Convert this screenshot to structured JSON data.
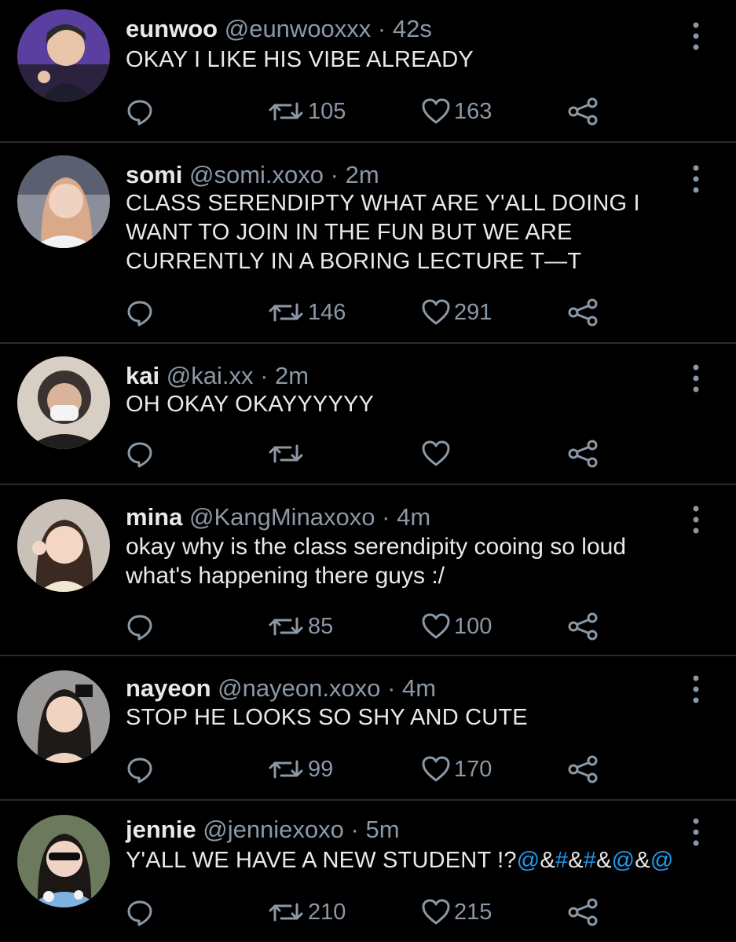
{
  "tweets": [
    {
      "name": "eunwoo",
      "handle": "@eunwooxxx",
      "time": "42s",
      "text": "OKAY I LIKE HIS VIBE ALREADY",
      "retweets": "105",
      "likes": "163"
    },
    {
      "name": "somi",
      "handle": "@somi.xoxo",
      "time": "2m",
      "text": "CLASS SERENDIPTY WHAT ARE Y'ALL DOING I WANT TO JOIN IN THE FUN BUT WE ARE CURRENTLY IN A BORING LECTURE T—T",
      "retweets": "146",
      "likes": "291"
    },
    {
      "name": "kai",
      "handle": "@kai.xx",
      "time": "2m",
      "text": "OH OKAY OKAYYYYYY",
      "retweets": "",
      "likes": ""
    },
    {
      "name": "mina",
      "handle": "@KangMinaxoxo",
      "time": "4m",
      "text": "okay why is the class serendipity cooing so loud what's happening there guys :/",
      "retweets": "85",
      "likes": "100"
    },
    {
      "name": "nayeon",
      "handle": "@nayeon.xoxo",
      "time": "4m",
      "text": "STOP HE LOOKS SO SHY AND CUTE",
      "retweets": "99",
      "likes": "170"
    },
    {
      "name": "jennie",
      "handle": "@jenniexoxo",
      "time": "5m",
      "text_prefix": "Y'ALL WE HAVE A NEW STUDENT !?",
      "text_parts": [
        "@",
        "&",
        "#",
        "&",
        "#",
        "&",
        "@",
        "&",
        "@"
      ],
      "retweets": "210",
      "likes": "215"
    }
  ],
  "separator": "·",
  "colors": {
    "background": "#000000",
    "text": "#e7e9ea",
    "muted": "#8b98a5",
    "accent": "#1d9bf0",
    "divider": "#2a2a2a"
  },
  "icons": {
    "reply": "reply-icon",
    "retweet": "retweet-icon",
    "like": "heart-icon",
    "share": "share-icon",
    "more": "more-icon"
  }
}
